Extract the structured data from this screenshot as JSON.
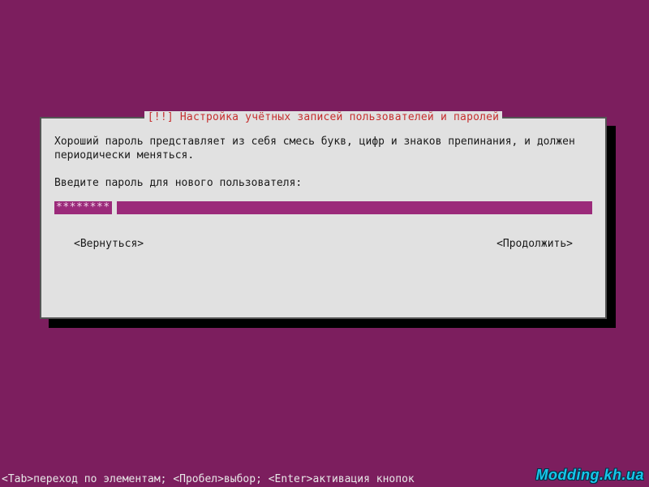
{
  "dialog": {
    "title_prefix": "[!!]",
    "title_text": "Настройка учётных записей пользователей и паролей",
    "description": "Хороший пароль представляет из себя смесь букв, цифр и знаков препинания, и должен периодически меняться.",
    "prompt": "Введите пароль для нового пользователя:",
    "password_masked": "********",
    "back_label": "<Вернуться>",
    "continue_label": "<Продолжить>"
  },
  "footer": {
    "help": "<Tab>переход по элементам; <Пробел>выбор; <Enter>активация кнопок"
  },
  "watermark": {
    "text": "Modding.kh.ua"
  }
}
